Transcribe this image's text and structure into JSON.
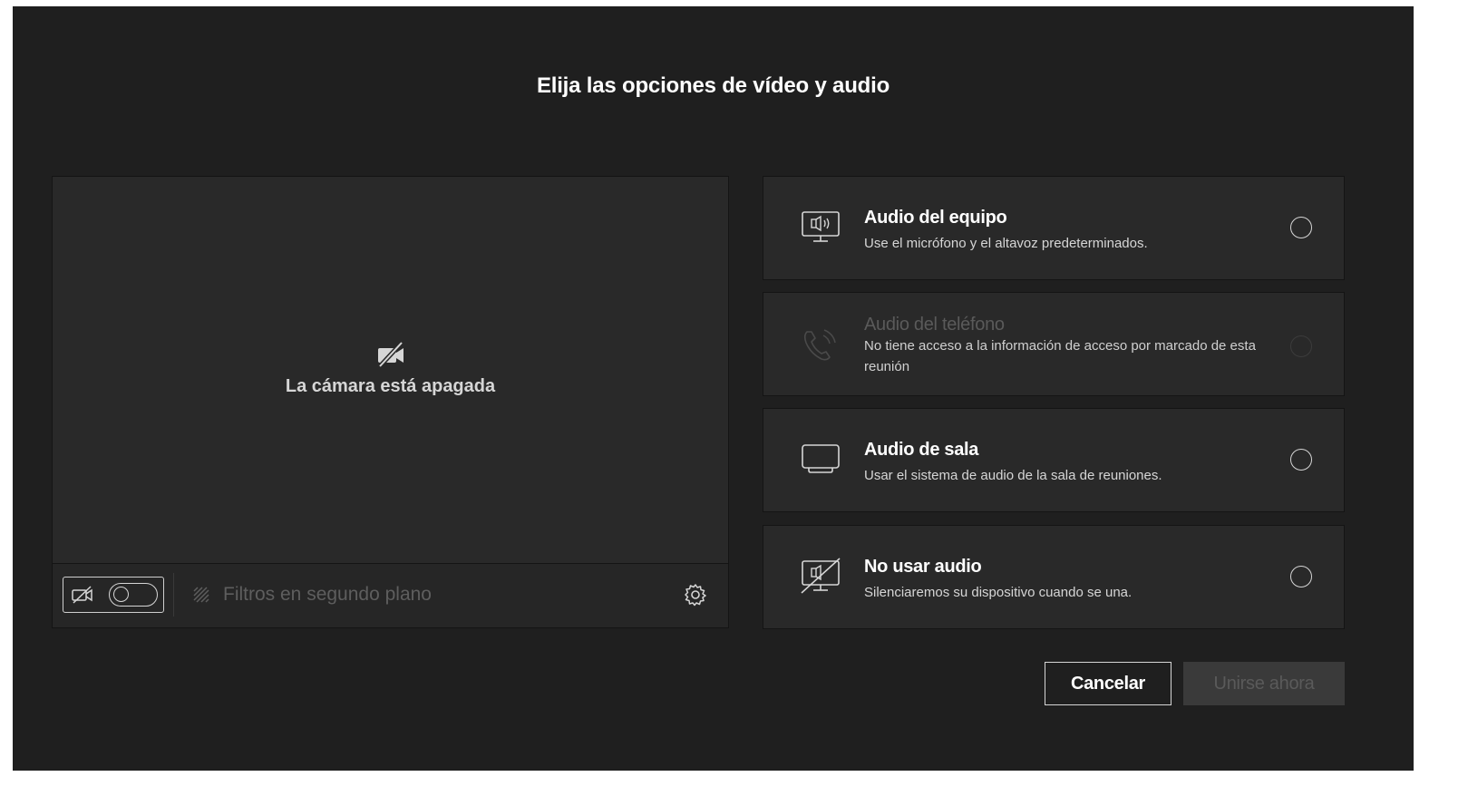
{
  "dialog": {
    "title": "Elija las opciones de vídeo y audio"
  },
  "preview": {
    "camera_status": "La cámara está apagada",
    "camera_toggle_on": false,
    "filters_label": "Filtros en segundo plano"
  },
  "audio_options": [
    {
      "icon": "computer-audio-icon",
      "title": "Audio del equipo",
      "description": "Use el micrófono y el altavoz predeterminados.",
      "enabled": true,
      "selected": false
    },
    {
      "icon": "phone-audio-icon",
      "title": "Audio del teléfono",
      "description": "No tiene acceso a la información de acceso por marcado de esta reunión",
      "enabled": false,
      "selected": false
    },
    {
      "icon": "room-audio-icon",
      "title": "Audio de sala",
      "description": "Usar el sistema de audio de la sala de reuniones.",
      "enabled": true,
      "selected": false
    },
    {
      "icon": "no-audio-icon",
      "title": "No usar audio",
      "description": "Silenciaremos su dispositivo cuando se una.",
      "enabled": true,
      "selected": false
    }
  ],
  "buttons": {
    "cancel_label": "Cancelar",
    "join_label": "Unirse ahora",
    "join_enabled": false
  },
  "colors": {
    "background": "#1f1f1f",
    "panel": "#292929",
    "text": "#ffffff",
    "muted_text": "#d6d6d6",
    "disabled_text": "#5a5a5a"
  }
}
